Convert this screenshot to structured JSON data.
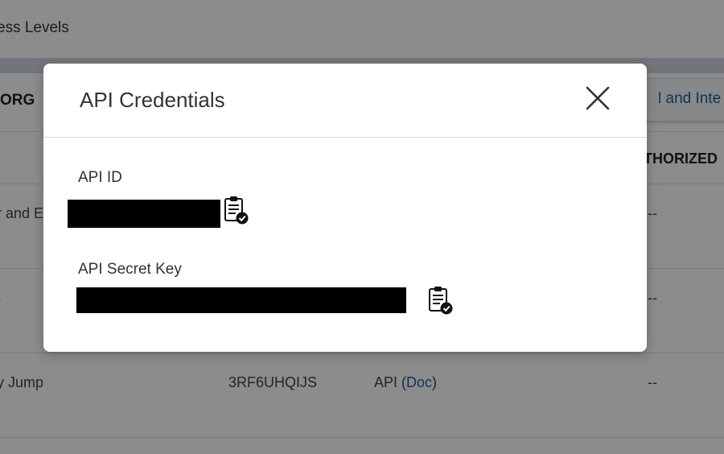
{
  "background": {
    "header_title": "ess Levels",
    "columns": {
      "org": "ORG",
      "authorized": "THORIZED"
    },
    "top_right_button": "l and Inte",
    "rows": [
      {
        "name": "r and E",
        "api_id": "",
        "type": "",
        "doc": "",
        "type_close": "",
        "authorized": "--"
      },
      {
        "name": "s",
        "api_id": "",
        "type": "",
        "doc": "",
        "type_close": "",
        "authorized": "--"
      },
      {
        "name": "y Jump",
        "api_id": "3RF6UHQIJS",
        "type": "API (",
        "doc": "Doc",
        "type_close": ")",
        "authorized": "--"
      }
    ]
  },
  "modal": {
    "title": "API Credentials",
    "close_icon": "close-icon",
    "api_id_label": "API ID",
    "api_secret_label": "API Secret Key",
    "copy_icon": "clipboard-check-icon",
    "redaction_color": "#000000"
  },
  "colors": {
    "overlay": "rgba(0,0,0,0.45)",
    "link": "#1f5f9e"
  }
}
